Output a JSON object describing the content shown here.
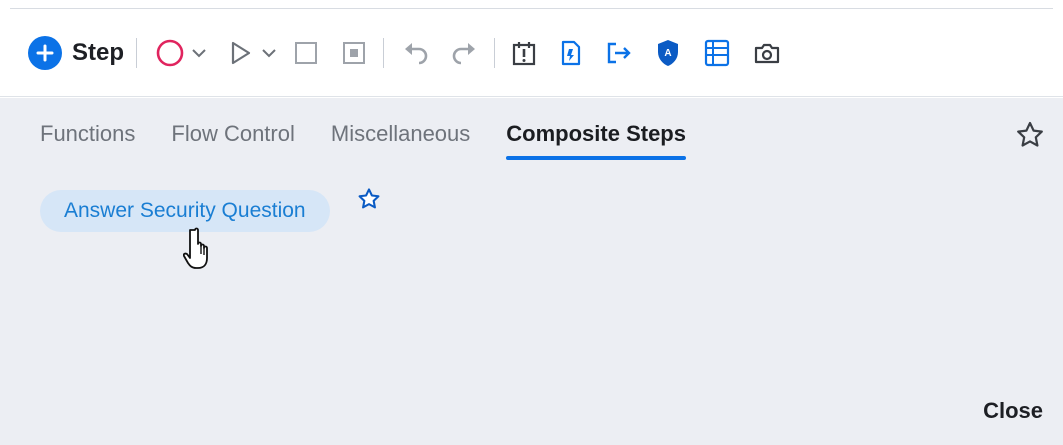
{
  "toolbar": {
    "add_step_label": "Step",
    "icons": [
      "plus-icon",
      "record-icon",
      "run-icon",
      "stop-icon",
      "pause-icon",
      "undo-icon",
      "redo-icon",
      "breakpoint-icon",
      "document-icon",
      "exit-icon",
      "shield-icon",
      "table-icon",
      "camera-icon"
    ],
    "accent_color": "#0b72e7",
    "record_color": "#e0245e"
  },
  "tabs": [
    {
      "label": "Functions"
    },
    {
      "label": "Flow Control"
    },
    {
      "label": "Miscellaneous"
    },
    {
      "label": "Composite Steps"
    }
  ],
  "active_tab": "Composite Steps",
  "composite_steps": {
    "items": [
      {
        "label": "Answer Security Question"
      }
    ]
  },
  "footer": {
    "close_label": "Close"
  }
}
